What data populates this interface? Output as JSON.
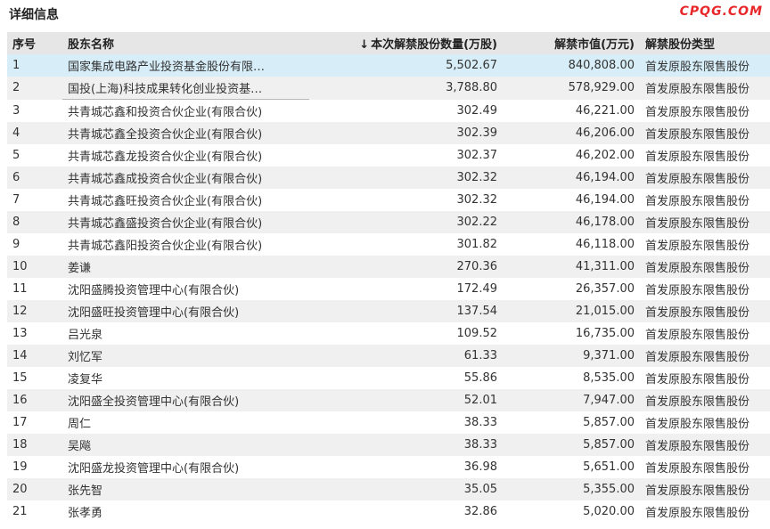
{
  "header": {
    "title": "详细信息",
    "logo_text": "CPQG.COM"
  },
  "table": {
    "columns": [
      "序号",
      "股东名称",
      "本次解禁股份数量(万股)",
      "解禁市值(万元)",
      "解禁股份类型"
    ],
    "sort_arrow": "↓",
    "rows": [
      [
        "1",
        "国家集成电路产业投资基金股份有限…",
        "5,502.67",
        "840,808.00",
        "首发原股东限售股份"
      ],
      [
        "2",
        "国投(上海)科技成果转化创业投资基…",
        "3,788.80",
        "578,929.00",
        "首发原股东限售股份"
      ],
      [
        "3",
        "共青城芯鑫和投资合伙企业(有限合伙)",
        "302.49",
        "46,221.00",
        "首发原股东限售股份"
      ],
      [
        "4",
        "共青城芯鑫全投资合伙企业(有限合伙)",
        "302.39",
        "46,206.00",
        "首发原股东限售股份"
      ],
      [
        "5",
        "共青城芯鑫龙投资合伙企业(有限合伙)",
        "302.37",
        "46,202.00",
        "首发原股东限售股份"
      ],
      [
        "6",
        "共青城芯鑫成投资合伙企业(有限合伙)",
        "302.32",
        "46,194.00",
        "首发原股东限售股份"
      ],
      [
        "7",
        "共青城芯鑫旺投资合伙企业(有限合伙)",
        "302.32",
        "46,194.00",
        "首发原股东限售股份"
      ],
      [
        "8",
        "共青城芯鑫盛投资合伙企业(有限合伙)",
        "302.22",
        "46,178.00",
        "首发原股东限售股份"
      ],
      [
        "9",
        "共青城芯鑫阳投资合伙企业(有限合伙)",
        "301.82",
        "46,118.00",
        "首发原股东限售股份"
      ],
      [
        "10",
        "姜谦",
        "270.36",
        "41,311.00",
        "首发原股东限售股份"
      ],
      [
        "11",
        "沈阳盛腾投资管理中心(有限合伙)",
        "172.49",
        "26,357.00",
        "首发原股东限售股份"
      ],
      [
        "12",
        "沈阳盛旺投资管理中心(有限合伙)",
        "137.54",
        "21,015.00",
        "首发原股东限售股份"
      ],
      [
        "13",
        "吕光泉",
        "109.52",
        "16,735.00",
        "首发原股东限售股份"
      ],
      [
        "14",
        "刘忆军",
        "61.33",
        "9,371.00",
        "首发原股东限售股份"
      ],
      [
        "15",
        "凌复华",
        "55.86",
        "8,535.00",
        "首发原股东限售股份"
      ],
      [
        "16",
        "沈阳盛全投资管理中心(有限合伙)",
        "52.01",
        "7,947.00",
        "首发原股东限售股份"
      ],
      [
        "17",
        "周仁",
        "38.33",
        "5,857.00",
        "首发原股东限售股份"
      ],
      [
        "18",
        "吴飚",
        "38.33",
        "5,857.00",
        "首发原股东限售股份"
      ],
      [
        "19",
        "沈阳盛龙投资管理中心(有限合伙)",
        "36.98",
        "5,651.00",
        "首发原股东限售股份"
      ],
      [
        "20",
        "张先智",
        "35.05",
        "5,355.00",
        "首发原股东限售股份"
      ],
      [
        "21",
        "张孝勇",
        "32.86",
        "5,020.00",
        "首发原股东限售股份"
      ]
    ]
  },
  "colors": {
    "header_bg": "#e6e6e6",
    "stripe_bg": "#f0f0f0",
    "selected_bg": "#d7eef8",
    "logo": "#e8272a"
  }
}
